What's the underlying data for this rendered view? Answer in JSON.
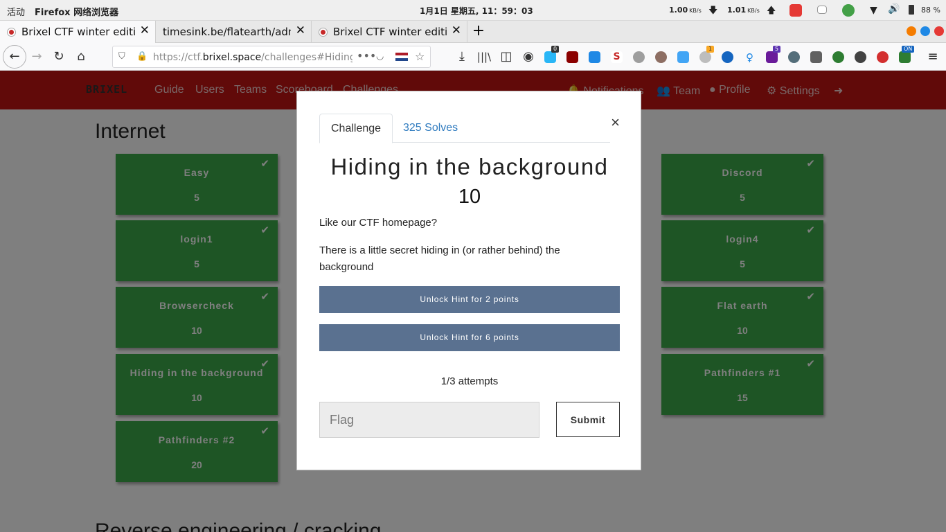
{
  "os": {
    "activities": "活动",
    "app_name": "Firefox 网络浏览器",
    "clock": "1月1日 星期五, 11：59：03",
    "net_down": "1.00",
    "net_up": "1.01",
    "net_unit": "KB/s",
    "battery": "88 %"
  },
  "browser": {
    "tabs": [
      {
        "title": "Brixel CTF winter edition",
        "active": true
      },
      {
        "title": "timesink.be/flatearth/admin",
        "active": false
      },
      {
        "title": "Brixel CTF winter edition",
        "active": false
      }
    ],
    "url_prefix": "https://ctf.",
    "url_domain": "brixel.space",
    "url_suffix": "/challenges#Hiding in the background",
    "badges": {
      "b0": "0",
      "b1": "1",
      "b2": "5",
      "b3": "ON"
    }
  },
  "site": {
    "brand": "BRIXEL",
    "nav_left": [
      "Guide",
      "Users",
      "Teams",
      "Scoreboard",
      "Challenges"
    ],
    "nav_right": [
      "Notifications",
      "Team",
      "Profile",
      "Settings"
    ],
    "section_title": "Internet",
    "section2_title": "Reverse engineering / cracking",
    "cards": [
      {
        "name": "Easy",
        "points": "5"
      },
      {
        "name": "Discord",
        "points": "5"
      },
      {
        "name": "login1",
        "points": "5"
      },
      {
        "name": "login4",
        "points": "5"
      },
      {
        "name": "Browsercheck",
        "points": "10"
      },
      {
        "name": "Flat earth",
        "points": "10"
      },
      {
        "name": "Hiding in the background",
        "points": "10"
      },
      {
        "name": "Pathfinders #1",
        "points": "15"
      },
      {
        "name": "Pathfinders #2",
        "points": "20"
      }
    ]
  },
  "modal": {
    "tab_challenge": "Challenge",
    "tab_solves": "325 Solves",
    "close": "×",
    "title": "Hiding in the background",
    "points": "10",
    "desc1": "Like our CTF homepage?",
    "desc2": "There is a little secret hiding in (or rather behind) the background",
    "hint1": "Unlock Hint for 2 points",
    "hint2": "Unlock Hint for 6 points",
    "attempts": "1/3 attempts",
    "flag_placeholder": "Flag",
    "submit": "Submit"
  }
}
